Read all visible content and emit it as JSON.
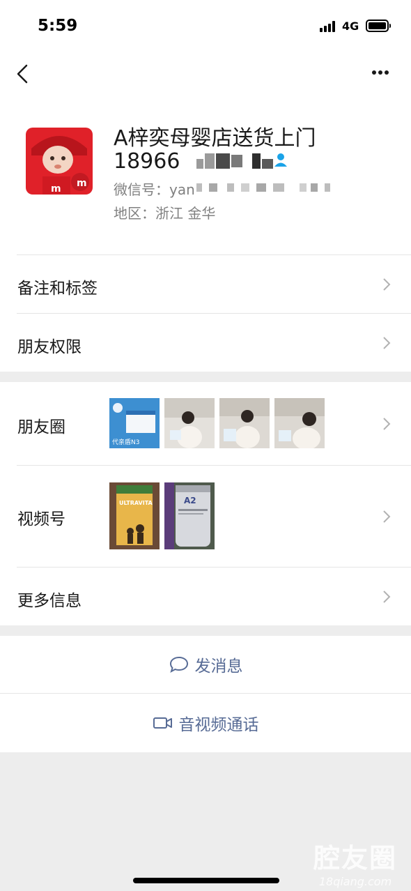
{
  "status_bar": {
    "time": "5:59",
    "network": "4G"
  },
  "nav": {
    "back_icon": "chevron-left-icon",
    "more_icon": "more-dots-icon"
  },
  "profile": {
    "name": "A梓奕母婴店送货上门",
    "phone_visible": "18966",
    "wechat_id_label": "微信号：yan",
    "region_label": "地区：浙江 金华",
    "contact_icon": "person-icon"
  },
  "menu": {
    "remark_tags": "备注和标签",
    "friend_permissions": "朋友权限",
    "moments": "朋友圈",
    "channels": "视频号",
    "more_info": "更多信息"
  },
  "moments_thumbs": [
    {
      "name": "moments-thumb-1",
      "caption": "代亲盾N3"
    },
    {
      "name": "moments-thumb-2",
      "caption": ""
    },
    {
      "name": "moments-thumb-3",
      "caption": ""
    },
    {
      "name": "moments-thumb-4",
      "caption": ""
    }
  ],
  "channels_thumbs": [
    {
      "name": "channels-thumb-1",
      "caption": "ULTRAVITA"
    },
    {
      "name": "channels-thumb-2",
      "caption": "A2"
    }
  ],
  "actions": {
    "send_message": "发消息",
    "av_call": "音视频通话"
  },
  "watermark": {
    "main": "腔友圈",
    "sub": "18qiang.com"
  },
  "colors": {
    "link": "#576b95",
    "background": "#ededed",
    "divider": "#e5e5e5"
  }
}
